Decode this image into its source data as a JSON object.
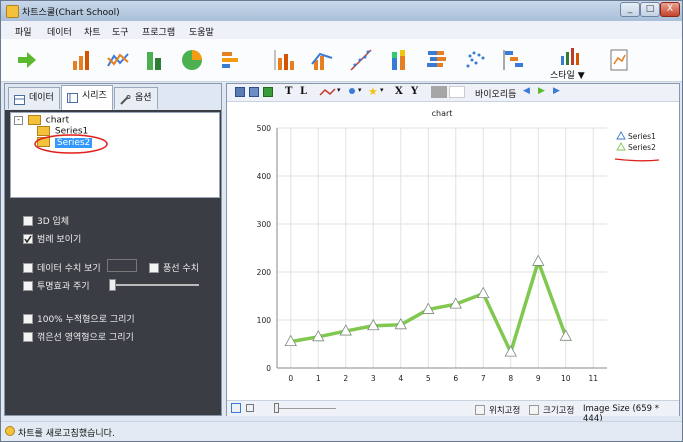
{
  "window": {
    "title": "차트스쿨(Chart School)",
    "controls": [
      "_",
      "□",
      "X"
    ]
  },
  "menu": [
    "파일",
    "데이터",
    "차트",
    "도구",
    "프로그램",
    "도움말"
  ],
  "toolbar": {
    "style_label": "스타일 ▼"
  },
  "left_panel": {
    "tabs": [
      {
        "label": "데이터",
        "active": false
      },
      {
        "label": "시리즈",
        "active": true
      },
      {
        "label": "옵션",
        "active": false
      }
    ],
    "tree": {
      "root": "chart",
      "children": [
        "Series1",
        "Series2"
      ],
      "selected": "Series2"
    },
    "options": {
      "3d": {
        "label": "3D 입체",
        "checked": false
      },
      "legend": {
        "label": "범례 보이기",
        "checked": true
      },
      "data_values": {
        "label": "데이터 수치 보기",
        "checked": false
      },
      "balloon": {
        "label": "풍선 수치",
        "checked": false
      },
      "transparency": {
        "label": "투명효과 주기",
        "checked": false
      },
      "stacked100": {
        "label": "100% 누적형으로 그리기",
        "checked": false
      },
      "area": {
        "label": "꺾은선 영역형으로 그리기",
        "checked": false
      }
    }
  },
  "chart_toolbar": {
    "t_label": "T",
    "l_label": "L",
    "x_label": "X",
    "y_label": "Y",
    "background_label": "바이오리듬"
  },
  "chart_bottom": {
    "pos_fix": "위치고정",
    "size_fix": "크기고정",
    "image_size": "Image Size (659 * 444)"
  },
  "status": "차트를 새로고침했습니다.",
  "chart_data": {
    "type": "line",
    "title": "chart",
    "x": [
      0,
      1,
      2,
      3,
      4,
      5,
      6,
      7,
      8,
      9,
      10
    ],
    "xticks": [
      "0",
      "1",
      "2",
      "3",
      "4",
      "5",
      "6",
      "7",
      "8",
      "9",
      "10",
      "11"
    ],
    "yticks": [
      "0",
      "100",
      "200",
      "300",
      "400",
      "500"
    ],
    "ylim": [
      0,
      500
    ],
    "xlim": [
      -0.5,
      11.5
    ],
    "series": [
      {
        "name": "Series2",
        "color": "#80c850",
        "values": [
          55,
          65,
          77,
          88,
          90,
          122,
          133,
          155,
          33,
          222,
          66
        ]
      }
    ],
    "legend": [
      "Series1",
      "Series2"
    ],
    "grid": true,
    "legend_position": "top-right"
  }
}
